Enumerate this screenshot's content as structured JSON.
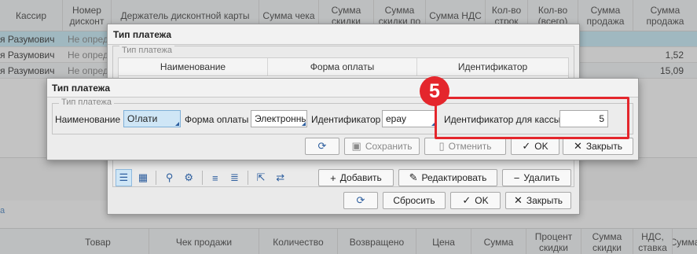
{
  "background": {
    "columns": [
      "Кассир",
      "Номер дисконт",
      "Держатель дисконтной карты",
      "Сумма чека",
      "Сумма скидки",
      "Сумма скидки по",
      "Сумма НДС",
      "Кол-во строк",
      "Кол-во (всего)",
      "Сумма продажа",
      "Сумма продажа"
    ],
    "rows": [
      {
        "cashier": "я Разумович",
        "discount": "Не опред",
        "sum": ""
      },
      {
        "cashier": "я Разумович",
        "discount": "Не опред",
        "sum": "1,52"
      },
      {
        "cashier": "я Разумович",
        "discount": "Не опред",
        "sum": "15,09"
      }
    ],
    "mark": "a",
    "footer_columns": [
      "Товар",
      "Чек продажи",
      "Количество",
      "Возвращено",
      "Цена",
      "Сумма",
      "Процент скидки",
      "Сумма скидки",
      "НДС, ставка",
      "Сумма"
    ]
  },
  "dialog_list": {
    "title": "Тип платежа",
    "group_legend": "Тип платежа",
    "columns": [
      "Наименование",
      "Форма оплаты",
      "Идентификатор"
    ],
    "buttons": {
      "add": "Добавить",
      "edit": "Редактировать",
      "delete": "Удалить",
      "reset": "Сбросить",
      "ok": "OK",
      "close": "Закрыть"
    }
  },
  "dialog_edit": {
    "title": "Тип платежа",
    "group_legend": "Тип платежа",
    "name_label": "Наименование",
    "name_value": "О!лати",
    "form_label": "Форма оплаты",
    "form_value": "Электронны",
    "id_label": "Идентификатор",
    "id_value": "epay",
    "cash_id_label": "Идентификатор для кассы",
    "cash_id_value": "5",
    "buttons": {
      "save": "Сохранить",
      "cancel": "Отменить",
      "ok": "OK",
      "close": "Закрыть"
    }
  },
  "annotation": {
    "number": "5",
    "color": "#e4262c"
  }
}
